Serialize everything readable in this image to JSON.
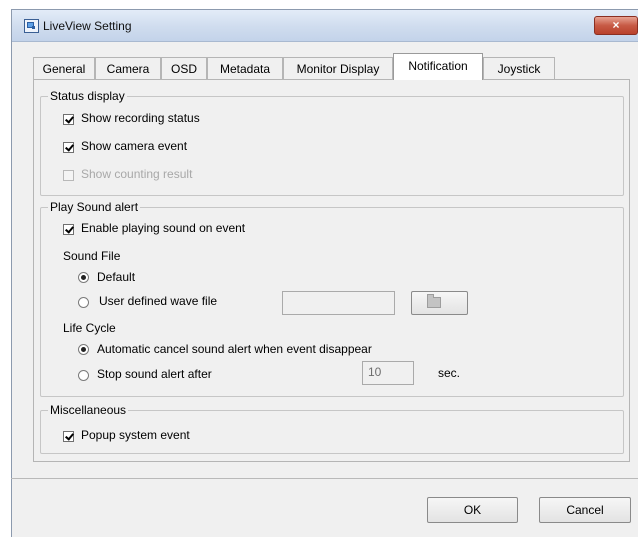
{
  "window": {
    "title": "LiveView Setting",
    "close_glyph": "×"
  },
  "tabs": [
    {
      "label": "General"
    },
    {
      "label": "Camera"
    },
    {
      "label": "OSD"
    },
    {
      "label": "Metadata"
    },
    {
      "label": "Monitor Display"
    },
    {
      "label": "Notification",
      "active": true
    },
    {
      "label": "Joystick"
    }
  ],
  "status_display": {
    "title": "Status display",
    "show_recording_status": {
      "label": "Show recording status",
      "checked": true
    },
    "show_camera_event": {
      "label": "Show camera event",
      "checked": true
    },
    "show_counting_result": {
      "label": "Show counting result",
      "checked": false,
      "disabled": true
    }
  },
  "play_sound_alert": {
    "title": "Play Sound alert",
    "enable": {
      "label": "Enable playing sound on event",
      "checked": true
    },
    "sound_file": {
      "title": "Sound File",
      "default": {
        "label": "Default",
        "selected": true
      },
      "user_defined": {
        "label": "User defined wave file",
        "selected": false
      },
      "path_value": "",
      "browse_icon": "folder-open-icon"
    },
    "life_cycle": {
      "title": "Life Cycle",
      "auto_cancel": {
        "label": "Automatic cancel sound alert when event disappear",
        "selected": true
      },
      "stop_after": {
        "label": "Stop sound alert after",
        "selected": false
      },
      "seconds_value": "10",
      "seconds_unit": "sec."
    }
  },
  "miscellaneous": {
    "title": "Miscellaneous",
    "popup_system_event": {
      "label": "Popup system event",
      "checked": true
    }
  },
  "buttons": {
    "ok": "OK",
    "cancel": "Cancel"
  },
  "colors": {
    "titlebar": "#cfdcee",
    "close": "#c75a45",
    "panel": "#f0f0f0"
  }
}
